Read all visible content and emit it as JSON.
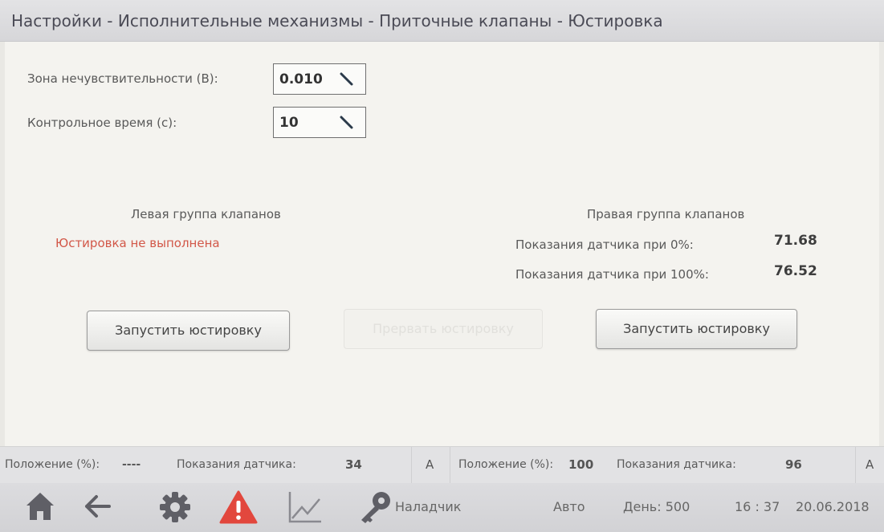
{
  "title": "Настройки - Исполнительные механизмы - Приточные клапаны - Юстировка",
  "settings": {
    "deadzone_label": "Зона нечувствительности (В):",
    "deadzone_value": "0.010",
    "control_time_label": "Контрольное время (с):",
    "control_time_value": "10"
  },
  "left_group": {
    "title": "Левая группа клапанов",
    "status": "Юстировка не выполнена",
    "start_button": "Запустить юстировку"
  },
  "abort_button": "Прервать юстировку",
  "right_group": {
    "title": "Правая группа клапанов",
    "reading_0_label": "Показания датчика при 0%:",
    "reading_0_value": "71.68",
    "reading_100_label": "Показания датчика при 100%:",
    "reading_100_value": "76.52",
    "start_button": "Запустить юстировку"
  },
  "status_left": {
    "position_label": "Положение (%):",
    "position_value": "----",
    "sensor_label": "Показания датчика:",
    "sensor_value": "34",
    "mode": "A"
  },
  "status_right": {
    "position_label": "Положение (%):",
    "position_value": "100",
    "sensor_label": "Показания датчика:",
    "sensor_value": "96",
    "mode": "A"
  },
  "bottom": {
    "icons": [
      "home-icon",
      "back-arrow-icon",
      "gear-icon",
      "warning-icon",
      "chart-icon",
      "key-icon"
    ],
    "user": "Наладчик",
    "mode": "Авто",
    "day": "День: 500",
    "time": "16 : 37",
    "date": "20.06.2018"
  },
  "colors": {
    "warning": "#e2473d",
    "status_error": "#d25748",
    "icon": "#5f5f66"
  }
}
